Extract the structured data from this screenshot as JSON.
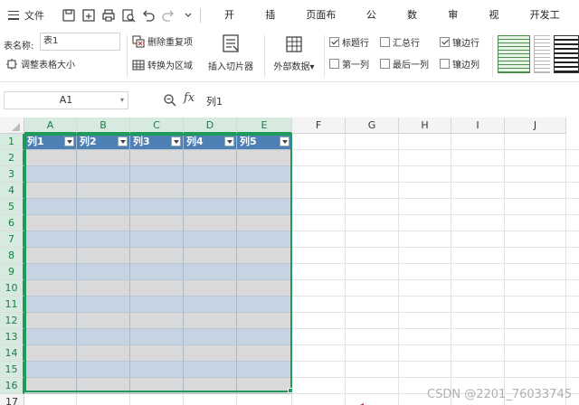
{
  "menubar": {
    "file_label": "文件",
    "tabs": [
      "开始",
      "插入",
      "页面布局",
      "公式",
      "数据",
      "审阅",
      "视图",
      "开发工具"
    ]
  },
  "ribbon": {
    "table_name_label": "表名称:",
    "table_name_value": "表1",
    "resize_label": "调整表格大小",
    "remove_duplicates_label": "删除重复项",
    "convert_to_range_label": "转换为区域",
    "insert_slicer_label": "插入切片器",
    "external_data_label": "外部数据",
    "options": [
      {
        "label": "标题行",
        "checked": true
      },
      {
        "label": "汇总行",
        "checked": false
      },
      {
        "label": "镶边行",
        "checked": true
      },
      {
        "label": "第一列",
        "checked": false
      },
      {
        "label": "最后一列",
        "checked": false
      },
      {
        "label": "镶边列",
        "checked": false
      }
    ]
  },
  "formula_bar": {
    "cell_ref": "A1",
    "fx_label": "fx",
    "content": "列1"
  },
  "sheet": {
    "columns": [
      "A",
      "B",
      "C",
      "D",
      "E",
      "F",
      "G",
      "H",
      "I",
      "J"
    ],
    "rows": [
      "1",
      "2",
      "3",
      "4",
      "5",
      "6",
      "7",
      "8",
      "9",
      "10",
      "11",
      "12",
      "13",
      "14",
      "15",
      "16",
      "17"
    ],
    "table_headers": [
      "列1",
      "列2",
      "列3",
      "列4",
      "列5"
    ]
  },
  "watermark": "CSDN @2201_76033745",
  "colors": {
    "table_header": "#4e7fb5",
    "selection": "#1e9b5a",
    "arrow": "#d0282e"
  }
}
